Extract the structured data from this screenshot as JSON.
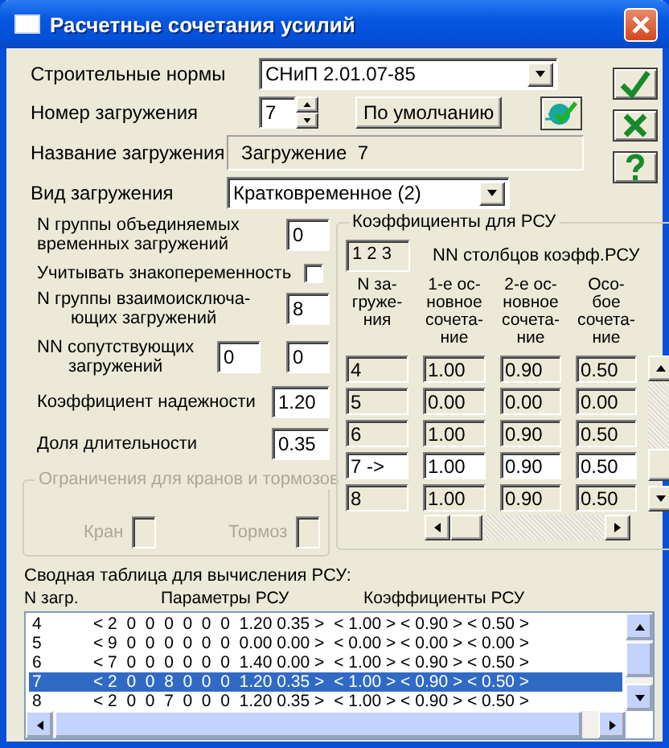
{
  "window": {
    "title": "Расчетные сочетания усилий"
  },
  "norms": {
    "label": "Строительные нормы",
    "value": "СНиП 2.01.07-85"
  },
  "load_number": {
    "label": "Номер загружения",
    "value": "7"
  },
  "default_button": "По умолчанию",
  "load_name": {
    "label": "Название загружения",
    "value": "Загружение  7"
  },
  "load_type": {
    "label": "Вид загружения",
    "value": "Кратковременное (2)"
  },
  "params": [
    {
      "kind": "field",
      "label": "N группы объединяемых\nвременных загружений",
      "values": [
        "0"
      ]
    },
    {
      "kind": "checkbox",
      "label": "Учитывать знакопеременность",
      "checked": false
    },
    {
      "kind": "field",
      "label": "N группы взаимоисключа-\nющих загружений",
      "values": [
        "8"
      ],
      "centered": true
    },
    {
      "kind": "field",
      "label": "NN сопутствующих\nзагружений",
      "values": [
        "0",
        "0"
      ],
      "centered": true
    },
    {
      "kind": "field",
      "label": "Коэффициент надежности",
      "values": [
        "1.20"
      ]
    },
    {
      "kind": "field",
      "label": "Доля длительности",
      "values": [
        "0.35"
      ]
    }
  ],
  "limits": {
    "title": "Ограничения для кранов и тормозов",
    "disabled": true,
    "fields": [
      {
        "label": "Кран"
      },
      {
        "label": "Тормоз"
      }
    ]
  },
  "coefficients": {
    "title": "Коэффициенты для РСУ",
    "columns_value": "1 2 3",
    "columns_label": "NN столбцов коэфф.РСУ",
    "headers": [
      "N за-\nгруже-\nния",
      "1-е ос-\nновное\nсочета-\nние",
      "2-е ос-\nновное\nсочета-\nние",
      "Осо-\nбое\nсочета-\nние"
    ],
    "rows": [
      {
        "cells": [
          "4",
          "1.00",
          "0.90",
          "0.50"
        ],
        "selected": false
      },
      {
        "cells": [
          "5",
          "0.00",
          "0.00",
          "0.00"
        ],
        "selected": false
      },
      {
        "cells": [
          "6",
          "1.00",
          "0.90",
          "0.50"
        ],
        "selected": false
      },
      {
        "cells": [
          "7 ->",
          "1.00",
          "0.90",
          "0.50"
        ],
        "selected": true
      },
      {
        "cells": [
          "8",
          "1.00",
          "0.90",
          "0.50"
        ],
        "selected": false
      }
    ]
  },
  "summary": {
    "title": "Сводная таблица для вычисления РСУ:",
    "headers": [
      "N загр.",
      "Параметры РСУ",
      "Коэффициенты РСУ"
    ],
    "rows": [
      {
        "n": "4",
        "params": "< 2  0  0  0  0  0  0  1.20 0.35 >",
        "coefs": "< 1.00 > < 0.90 > < 0.50 >",
        "selected": false
      },
      {
        "n": "5",
        "params": "< 9  0  0  0  0  0  0  0.00 0.00 >",
        "coefs": "< 0.00 > < 0.00 > < 0.00 >",
        "selected": false
      },
      {
        "n": "6",
        "params": "< 7  0  0  0  0  0  0  1.40 0.00 >",
        "coefs": "< 1.00 > < 0.90 > < 0.50 >",
        "selected": false
      },
      {
        "n": "7",
        "params": "< 2  0  0  8  0  0  0  1.20 0.35 >",
        "coefs": "< 1.00 > < 0.90 > < 0.50 >",
        "selected": true
      },
      {
        "n": "8",
        "params": "< 2  0  0  7  0  0  0  1.20 0.35 >",
        "coefs": "< 1.00 > < 0.90 > < 0.50 >",
        "selected": false
      }
    ]
  }
}
